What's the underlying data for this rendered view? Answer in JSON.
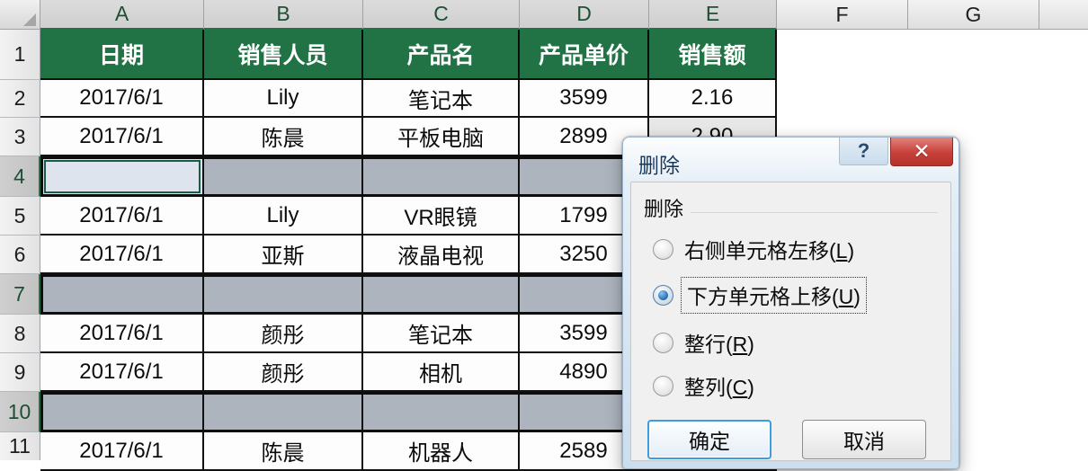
{
  "spreadsheet": {
    "column_headers": [
      "A",
      "B",
      "C",
      "D",
      "E",
      "F",
      "G"
    ],
    "row_headers": [
      "1",
      "2",
      "3",
      "4",
      "5",
      "6",
      "7",
      "8",
      "9",
      "10",
      "11"
    ],
    "selected_columns": [
      "A",
      "B",
      "C",
      "D",
      "E"
    ],
    "selected_rows": [
      "4",
      "7",
      "10"
    ],
    "active_cell": "A4",
    "header_fill": "#217346",
    "selection_fill": "#adb4bd",
    "table_headers": [
      "日期",
      "销售人员",
      "产品名",
      "产品单价",
      "销售额"
    ],
    "rows": [
      {
        "row": "2",
        "selected": false,
        "cells": [
          "2017/6/1",
          "Lily",
          "笔记本",
          "3599",
          "2.16"
        ]
      },
      {
        "row": "3",
        "selected": false,
        "cells": [
          "2017/6/1",
          "陈晨",
          "平板电脑",
          "2899",
          "2.90"
        ]
      },
      {
        "row": "4",
        "selected": true,
        "cells": [
          "",
          "",
          "",
          "",
          ""
        ]
      },
      {
        "row": "5",
        "selected": false,
        "cells": [
          "2017/6/1",
          "Lily",
          "VR眼镜",
          "1799",
          ""
        ]
      },
      {
        "row": "6",
        "selected": false,
        "cells": [
          "2017/6/1",
          "亚斯",
          "液晶电视",
          "3250",
          ""
        ]
      },
      {
        "row": "7",
        "selected": true,
        "cells": [
          "",
          "",
          "",
          "",
          ""
        ]
      },
      {
        "row": "8",
        "selected": false,
        "cells": [
          "2017/6/1",
          "颜彤",
          "笔记本",
          "3599",
          ""
        ]
      },
      {
        "row": "9",
        "selected": false,
        "cells": [
          "2017/6/1",
          "颜彤",
          "相机",
          "4890",
          ""
        ]
      },
      {
        "row": "10",
        "selected": true,
        "cells": [
          "",
          "",
          "",
          "",
          ""
        ]
      },
      {
        "row": "11",
        "selected": false,
        "cells": [
          "2017/6/1",
          "陈晨",
          "机器人",
          "2589",
          ""
        ]
      }
    ]
  },
  "dialog": {
    "title": "删除",
    "help_label": "?",
    "close_label": "✕",
    "group_legend": "删除",
    "options": [
      {
        "label_main": "右侧单元格左移(",
        "accel": "L",
        "label_end": ")",
        "selected": false,
        "focused": false,
        "highlighted": false
      },
      {
        "label_main": "下方单元格上移(",
        "accel": "U",
        "label_end": ")",
        "selected": true,
        "focused": true,
        "highlighted": true
      },
      {
        "label_main": "整行(",
        "accel": "R",
        "label_end": ")",
        "selected": false,
        "focused": false,
        "highlighted": false
      },
      {
        "label_main": "整列(",
        "accel": "C",
        "label_end": ")",
        "selected": false,
        "focused": false,
        "highlighted": false
      }
    ],
    "ok_label": "确定",
    "cancel_label": "取消",
    "highlight_color": "#e02020"
  }
}
